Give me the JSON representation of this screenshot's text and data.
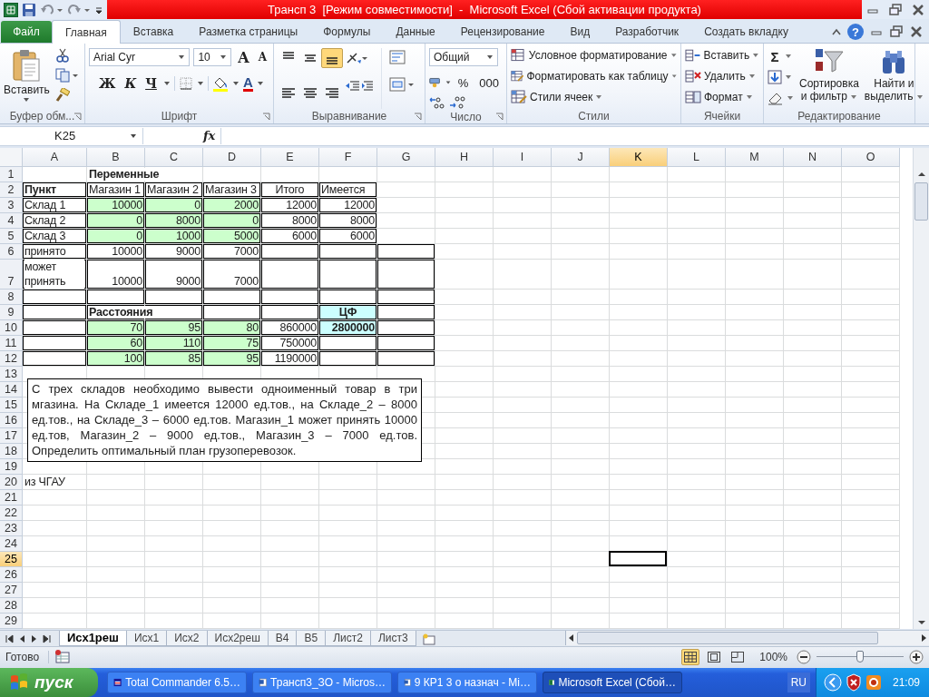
{
  "window": {
    "title": "Трансп 3  [Режим совместимости]  -  Microsoft Excel (Сбой активации продукта)"
  },
  "tabs": [
    {
      "label": "Файл",
      "kind": "file",
      "selected": false
    },
    {
      "label": "Главная",
      "kind": "tab",
      "selected": true
    },
    {
      "label": "Вставка",
      "kind": "tab",
      "selected": false
    },
    {
      "label": "Разметка страницы",
      "kind": "tab",
      "selected": false
    },
    {
      "label": "Формулы",
      "kind": "tab",
      "selected": false
    },
    {
      "label": "Данные",
      "kind": "tab",
      "selected": false
    },
    {
      "label": "Рецензирование",
      "kind": "tab",
      "selected": false
    },
    {
      "label": "Вид",
      "kind": "tab",
      "selected": false
    },
    {
      "label": "Разработчик",
      "kind": "tab",
      "selected": false
    },
    {
      "label": "Создать вкладку",
      "kind": "tab",
      "selected": false
    }
  ],
  "help": "?",
  "ribbon": {
    "clipboard": {
      "label": "Буфер обм...",
      "paste": "Вставить"
    },
    "font": {
      "label": "Шрифт",
      "name": "Arial Cyr",
      "size": "10",
      "grow": "A",
      "shrink": "A",
      "bold": "Ж",
      "italic": "К",
      "underline": "Ч",
      "color_letter": "A"
    },
    "alignment": {
      "label": "Выравнивание",
      "buttons": [
        {
          "kind": "top",
          "selected": false
        },
        {
          "kind": "middle",
          "selected": false
        },
        {
          "kind": "bottom",
          "selected": true
        },
        {
          "kind": "left",
          "selected": false
        },
        {
          "kind": "center",
          "selected": false
        },
        {
          "kind": "right",
          "selected": false
        }
      ]
    },
    "number": {
      "label": "Число",
      "format": "Общий",
      "percent": "%",
      "thousands": "000"
    },
    "styles": {
      "label": "Стили",
      "items": [
        "Условное форматирование",
        "Форматировать как таблицу",
        "Стили ячеек"
      ]
    },
    "cells": {
      "label": "Ячейки",
      "items": [
        "Вставить",
        "Удалить",
        "Формат"
      ]
    },
    "editing": {
      "label": "Редактирование",
      "sum": "Σ",
      "sort": [
        "Сортировка",
        "и фильтр"
      ],
      "find": [
        "Найти и",
        "выделить"
      ]
    }
  },
  "formula_bar": {
    "name_box": "K25",
    "fx": "fx"
  },
  "grid": {
    "columns": [
      {
        "label": "A",
        "selected": false
      },
      {
        "label": "B",
        "selected": false
      },
      {
        "label": "C",
        "selected": false
      },
      {
        "label": "D",
        "selected": false
      },
      {
        "label": "E",
        "selected": false
      },
      {
        "label": "F",
        "selected": false
      },
      {
        "label": "G",
        "selected": false
      },
      {
        "label": "H",
        "selected": false
      },
      {
        "label": "I",
        "selected": false
      },
      {
        "label": "J",
        "selected": false
      },
      {
        "label": "K",
        "selected": true
      },
      {
        "label": "L",
        "selected": false
      },
      {
        "label": "M",
        "selected": false
      },
      {
        "label": "N",
        "selected": false
      },
      {
        "label": "O",
        "selected": false
      }
    ],
    "rows": [
      {
        "number": "1",
        "selected": false,
        "cells": [
          {},
          {
            "text": "Переменные",
            "bold": true
          }
        ]
      },
      {
        "number": "2",
        "selected": false,
        "cells": [
          {
            "text": "Пункт",
            "bold": true,
            "bordered": true
          },
          {
            "text": "Магазин 1",
            "bordered": true
          },
          {
            "text": "Магазин 2",
            "bordered": true
          },
          {
            "text": "Магазин 3",
            "bordered": true
          },
          {
            "text": "Итого",
            "kind": "centered",
            "bordered": true
          },
          {
            "text": "Имеется",
            "bordered": true
          }
        ]
      },
      {
        "number": "3",
        "selected": false,
        "cells": [
          {
            "text": "Склад 1",
            "bordered": true
          },
          {
            "text": "10000",
            "kind": "number",
            "bordered": true,
            "color": "#ccffcc"
          },
          {
            "text": "0",
            "kind": "number",
            "bordered": true,
            "color": "#ccffcc"
          },
          {
            "text": "2000",
            "kind": "number",
            "bordered": true,
            "color": "#ccffcc"
          },
          {
            "text": "12000",
            "kind": "number",
            "bordered": true
          },
          {
            "text": "12000",
            "kind": "number",
            "bordered": true
          }
        ]
      },
      {
        "number": "4",
        "selected": false,
        "cells": [
          {
            "text": "Склад 2",
            "bordered": true
          },
          {
            "text": "0",
            "kind": "number",
            "bordered": true,
            "color": "#ccffcc"
          },
          {
            "text": "8000",
            "kind": "number",
            "bordered": true,
            "color": "#ccffcc"
          },
          {
            "text": "0",
            "kind": "number",
            "bordered": true,
            "color": "#ccffcc"
          },
          {
            "text": "8000",
            "kind": "number",
            "bordered": true
          },
          {
            "text": "8000",
            "kind": "number",
            "bordered": true
          }
        ]
      },
      {
        "number": "5",
        "selected": false,
        "cells": [
          {
            "text": "Склад 3",
            "bordered": true
          },
          {
            "text": "0",
            "kind": "number",
            "bordered": true,
            "color": "#ccffcc"
          },
          {
            "text": "1000",
            "kind": "number",
            "bordered": true,
            "color": "#ccffcc"
          },
          {
            "text": "5000",
            "kind": "number",
            "bordered": true,
            "color": "#ccffcc"
          },
          {
            "text": "6000",
            "kind": "number",
            "bordered": true
          },
          {
            "text": "6000",
            "kind": "number",
            "bordered": true
          }
        ]
      },
      {
        "number": "6",
        "selected": false,
        "cells": [
          {
            "text": "принято",
            "bordered": true
          },
          {
            "text": "10000",
            "kind": "number",
            "bordered": true
          },
          {
            "text": "9000",
            "kind": "number",
            "bordered": true
          },
          {
            "text": "7000",
            "kind": "number",
            "bordered": true
          },
          {
            "bordered": true
          },
          {
            "bordered": true
          },
          {
            "bordered": true
          }
        ]
      },
      {
        "number": "7",
        "selected": false,
        "cells": [
          {
            "text": "может принять",
            "wrap": true,
            "bordered": true
          },
          {
            "text": "10000",
            "kind": "number",
            "bordered": true
          },
          {
            "text": "9000",
            "kind": "number",
            "bordered": true
          },
          {
            "text": "7000",
            "kind": "number",
            "bordered": true
          },
          {
            "bordered": true
          },
          {
            "bordered": true
          },
          {
            "bordered": true
          }
        ]
      },
      {
        "number": "8",
        "selected": false,
        "cells": [
          {
            "bordered": true
          },
          {
            "bordered": true
          },
          {
            "bordered": true
          },
          {
            "bordered": true
          },
          {
            "bordered": true
          },
          {
            "bordered": true
          },
          {
            "bordered": true
          }
        ]
      },
      {
        "number": "9",
        "selected": false,
        "cells": [
          {
            "bordered": true
          },
          {
            "text": "Расстояния",
            "bold": true,
            "bordered": true
          },
          {
            "bordered": true
          },
          {
            "bordered": true
          },
          {
            "bordered": true
          },
          {
            "text": "ЦФ",
            "bold": true,
            "kind": "centered",
            "bordered": true,
            "color": "#ccffff"
          },
          {
            "bordered": true
          }
        ]
      },
      {
        "number": "10",
        "selected": false,
        "cells": [
          {
            "bordered": true
          },
          {
            "text": "70",
            "kind": "number",
            "bordered": true,
            "color": "#ccffcc"
          },
          {
            "text": "95",
            "kind": "number",
            "bordered": true,
            "color": "#ccffcc"
          },
          {
            "text": "80",
            "kind": "number",
            "bordered": true,
            "color": "#ccffcc"
          },
          {
            "text": "860000",
            "kind": "number",
            "bordered": true
          },
          {
            "text": "2800000",
            "bold": true,
            "kind": "number",
            "bordered": true,
            "color": "#ccffff"
          },
          {
            "bordered": true
          }
        ]
      },
      {
        "number": "11",
        "selected": false,
        "cells": [
          {
            "bordered": true
          },
          {
            "text": "60",
            "kind": "number",
            "bordered": true,
            "color": "#ccffcc"
          },
          {
            "text": "110",
            "kind": "number",
            "bordered": true,
            "color": "#ccffcc"
          },
          {
            "text": "75",
            "kind": "number",
            "bordered": true,
            "color": "#ccffcc"
          },
          {
            "text": "750000",
            "kind": "number",
            "bordered": true
          },
          {
            "bordered": true
          },
          {
            "bordered": true
          }
        ]
      },
      {
        "number": "12",
        "selected": false,
        "cells": [
          {
            "bordered": true
          },
          {
            "text": "100",
            "kind": "number",
            "bordered": true,
            "color": "#ccffcc"
          },
          {
            "text": "85",
            "kind": "number",
            "bordered": true,
            "color": "#ccffcc"
          },
          {
            "text": "95",
            "kind": "number",
            "bordered": true,
            "color": "#ccffcc"
          },
          {
            "text": "1190000",
            "kind": "number",
            "bordered": true
          },
          {
            "bordered": true
          },
          {
            "bordered": true
          }
        ]
      },
      {
        "number": "13",
        "selected": false
      },
      {
        "number": "14",
        "selected": false
      },
      {
        "number": "15",
        "selected": false
      },
      {
        "number": "16",
        "selected": false
      },
      {
        "number": "17",
        "selected": false
      },
      {
        "number": "18",
        "selected": false
      },
      {
        "number": "19",
        "selected": false
      },
      {
        "number": "20",
        "selected": false,
        "cells": [
          {
            "text": "из ЧГАУ"
          }
        ]
      },
      {
        "number": "21",
        "selected": false
      },
      {
        "number": "22",
        "selected": false
      },
      {
        "number": "23",
        "selected": false
      },
      {
        "number": "24",
        "selected": false
      },
      {
        "number": "25",
        "selected": true
      },
      {
        "number": "26",
        "selected": false
      },
      {
        "number": "27",
        "selected": false
      },
      {
        "number": "28",
        "selected": false
      },
      {
        "number": "29",
        "selected": false
      }
    ],
    "note": "С трех складов необходимо вывести одноименный товар в три мгазина. На Складе_1 имеется 12000 ед.тов., на Складе_2 – 8000 ед.тов., на Складе_3 – 6000 ед.тов. Магазин_1 может принять 10000 ед.тов, Магазин_2 – 9000 ед.тов., Магазин_3 – 7000 ед.тов. Определить оптимальный план грузоперевозок."
  },
  "sheet_tabs": [
    {
      "label": "Исх1реш",
      "selected": true
    },
    {
      "label": "Исх1",
      "selected": false
    },
    {
      "label": "Исх2",
      "selected": false
    },
    {
      "label": "Исх2реш",
      "selected": false
    },
    {
      "label": "В4",
      "selected": false
    },
    {
      "label": "В5",
      "selected": false
    },
    {
      "label": "Лист2",
      "selected": false
    },
    {
      "label": "Лист3",
      "selected": false
    }
  ],
  "status_bar": {
    "text": "Готово",
    "views": [
      {
        "kind": "normal",
        "selected": true
      },
      {
        "kind": "layout",
        "selected": false
      },
      {
        "kind": "pagebreak",
        "selected": false
      }
    ],
    "zoom": {
      "reading": "100%",
      "level": 0.5
    }
  },
  "taskbar": {
    "start": "пуск",
    "tasks": [
      {
        "label": "Total Commander 6.5…",
        "kind": "disk",
        "selected": false
      },
      {
        "label": "Трансп3_ЗО - Micros…",
        "kind": "doc",
        "selected": false
      },
      {
        "label": "9 КР1 3 о назнач - Mi…",
        "kind": "doc",
        "selected": false
      },
      {
        "label": "Microsoft Excel (Сбой…",
        "kind": "sheet",
        "selected": true
      }
    ],
    "language": "RU",
    "clock": "21:09"
  }
}
